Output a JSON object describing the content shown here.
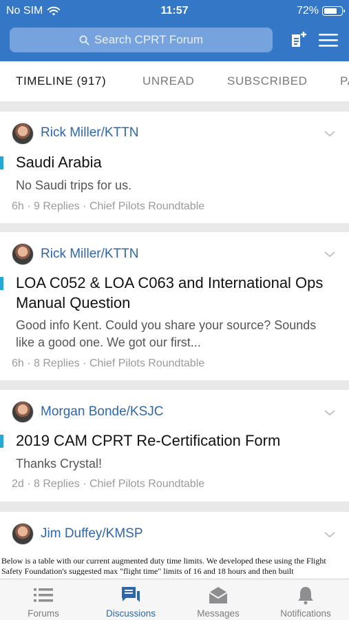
{
  "status_bar": {
    "carrier": "No SIM",
    "time": "11:57",
    "battery": "72%"
  },
  "header": {
    "search_placeholder": "Search CPRT Forum",
    "brand_color": "#3477c6"
  },
  "tabs": [
    {
      "label": "TIMELINE (917)",
      "active": true
    },
    {
      "label": "UNREAD",
      "active": false
    },
    {
      "label": "SUBSCRIBED",
      "active": false
    },
    {
      "label": "PA",
      "active": false
    }
  ],
  "posts": [
    {
      "author": "Rick Miller/KTTN",
      "title": "Saudi Arabia",
      "excerpt": "No Saudi trips for us.",
      "meta": "6h · 9 Replies · Chief Pilots Roundtable"
    },
    {
      "author": "Rick Miller/KTTN",
      "title": "LOA C052 & LOA C063 and International Ops Manual Question",
      "excerpt": "Good info Kent. Could you share your source? Sounds like a good one. We got our first...",
      "meta": "6h · 8 Replies · Chief Pilots Roundtable"
    },
    {
      "author": "Morgan Bonde/KSJC",
      "title": "2019 CAM CPRT Re-Certification Form",
      "excerpt": "Thanks Crystal!",
      "meta": "2d · 8 Replies · Chief Pilots Roundtable"
    },
    {
      "author": "Jim Duffey/KMSP",
      "preview": "Below is a table with our current augmented duty time limits. We developed these using the Flight Safety Foundation's suggested max \"flight time\" limits of 16 and 18 hours and then built"
    }
  ],
  "tab_bar": {
    "items": [
      {
        "label": "Forums",
        "icon": "list-icon"
      },
      {
        "label": "Discussions",
        "icon": "chat-icon"
      },
      {
        "label": "Messages",
        "icon": "envelope-icon"
      },
      {
        "label": "Notifications",
        "icon": "bell-icon"
      }
    ],
    "active_color": "#2f66aa"
  }
}
